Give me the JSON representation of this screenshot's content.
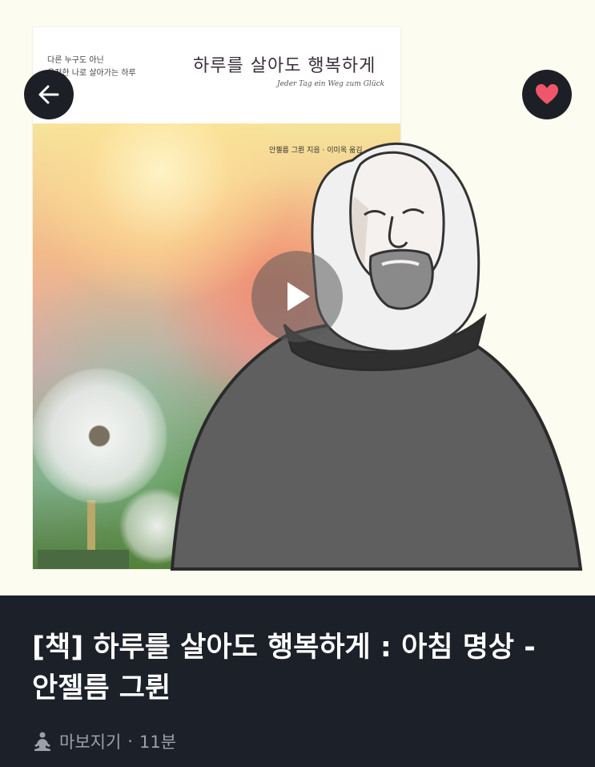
{
  "book": {
    "tagline_1": "다른 누구도 아닌",
    "tagline_2": "온전한 나로 살아가는 하루",
    "title": "하루를 살아도 행복하게",
    "subtitle": "Jeder Tag ein Weg zum Glück",
    "author_line": "안젤름 그륀 지음 · 이미옥 옮김"
  },
  "post": {
    "title": "[책] 하루를 살아도 행복하게 : 아침 명상 - 안젤름 그륀",
    "author": "마보지기",
    "separator": "·",
    "duration": "11분"
  },
  "icons": {
    "back": "arrow-left-icon",
    "favorite": "heart-icon",
    "play": "play-icon",
    "author": "meditation-person-icon"
  },
  "colors": {
    "info_background": "#1c2029",
    "heart": "#f0566a",
    "nav_button": "#1c1f26",
    "page_background": "#fdfcf0"
  }
}
